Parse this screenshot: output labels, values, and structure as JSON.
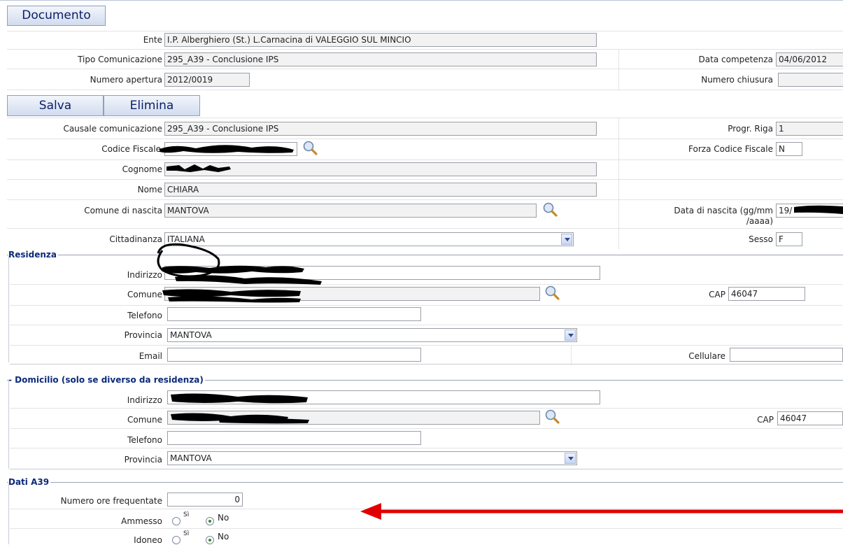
{
  "document_tab": "Documento",
  "header": {
    "ente_label": "Ente",
    "ente_value": "I.P. Alberghiero  (St.)  L.Carnacina di VALEGGIO SUL MINCIO",
    "tipo_label": "Tipo Comunicazione",
    "tipo_value": "295_A39 - Conclusione IPS",
    "data_competenza_label": "Data competenza",
    "data_competenza_value": "04/06/2012",
    "numero_apertura_label": "Numero apertura",
    "numero_apertura_value": "2012/0019",
    "numero_chiusura_label": "Numero chiusura",
    "numero_chiusura_value": ""
  },
  "actions": {
    "save": "Salva",
    "delete": "Elimina"
  },
  "person": {
    "causale_label": "Causale comunicazione",
    "causale_value": "295_A39 - Conclusione IPS",
    "progr_label": "Progr. Riga",
    "progr_value": "1",
    "cf_label": "Codice Fiscale",
    "forza_label": "Forza Codice Fiscale",
    "forza_value": "N",
    "cognome_label": "Cognome",
    "nome_label": "Nome",
    "nome_value": "CHIARA",
    "comune_nascita_label": "Comune di nascita",
    "comune_nascita_value": "MANTOVA",
    "data_nascita_label_1": "Data di nascita (gg/mm",
    "data_nascita_label_2": "/aaaa)",
    "data_nascita_value": "19/",
    "cittadinanza_label": "Cittadinanza",
    "cittadinanza_value": "ITALIANA",
    "sesso_label": "Sesso",
    "sesso_value": "F"
  },
  "residenza": {
    "title": "Residenza",
    "indirizzo_label": "Indirizzo",
    "comune_label": "Comune",
    "cap_label": "CAP",
    "cap_value": "46047",
    "telefono_label": "Telefono",
    "provincia_label": "Provincia",
    "provincia_value": "MANTOVA",
    "email_label": "Email",
    "cellulare_label": "Cellulare"
  },
  "domicilio": {
    "title": "- Domicilio (solo se diverso da residenza)",
    "indirizzo_label": "Indirizzo",
    "comune_label": "Comune",
    "cap_label": "CAP",
    "cap_value": "46047",
    "telefono_label": "Telefono",
    "provincia_label": "Provincia",
    "provincia_value": "MANTOVA"
  },
  "dati_a39": {
    "title": "Dati A39",
    "ore_label": "Numero ore frequentate",
    "ore_value": "0",
    "ammesso_label": "Ammesso",
    "idoneo_label": "Idoneo",
    "si_label": "Sì",
    "no_label": "No",
    "ammesso_selected": "No",
    "idoneo_selected": "No"
  },
  "colors": {
    "accent": "#0c2a7a",
    "annotation": "#e00000",
    "redaction": "#000000"
  },
  "icons": [
    "magnifier-icon",
    "dropdown-arrow-icon"
  ]
}
